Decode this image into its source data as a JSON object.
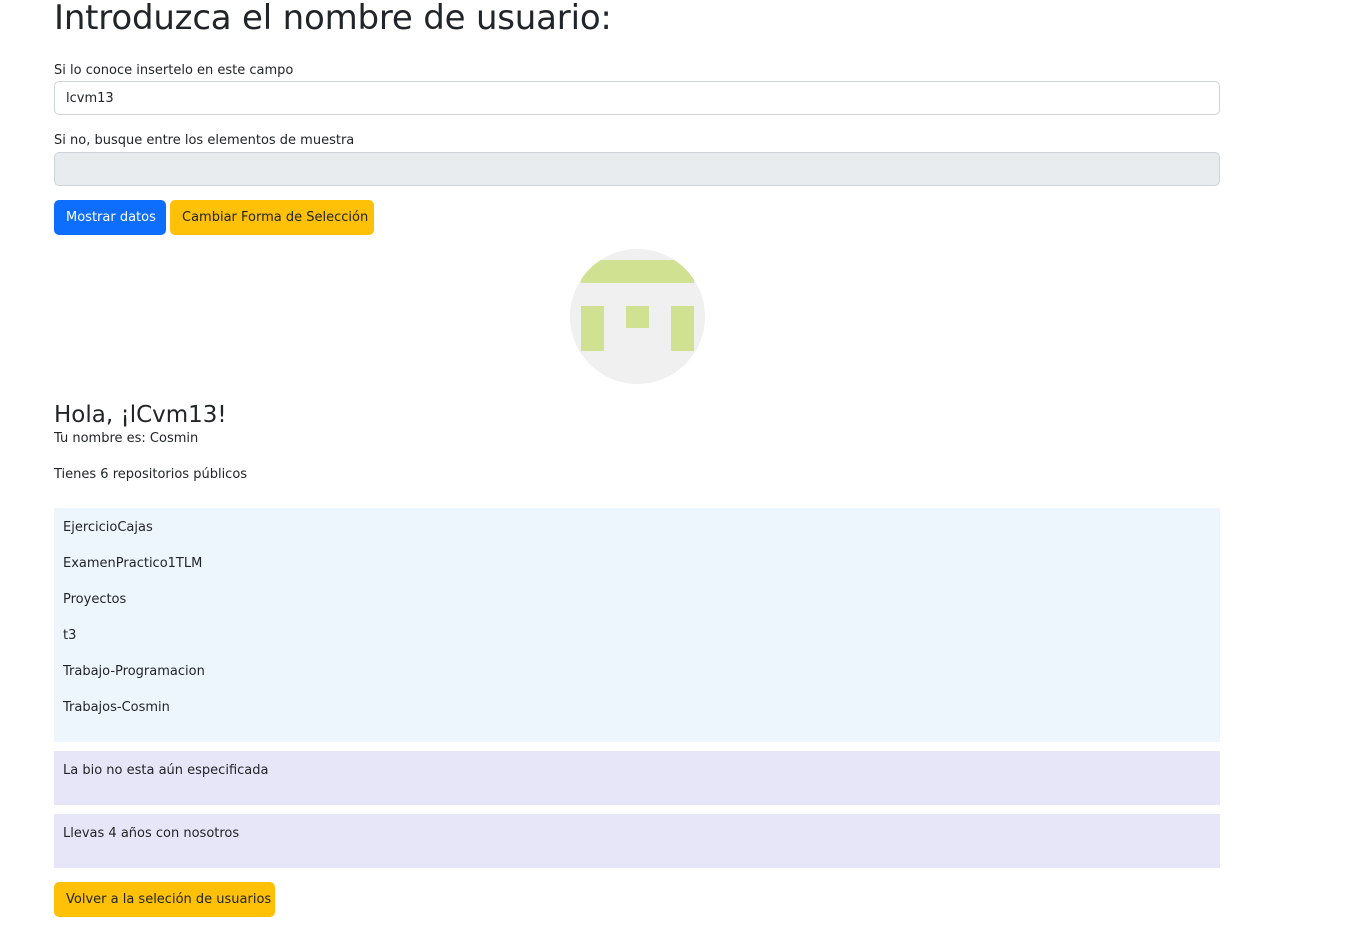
{
  "header": {
    "title": "Introduzca el nombre de usuario:"
  },
  "form": {
    "known_label": "Si lo conoce insertelo en este campo",
    "username_value": "lcvm13",
    "username_placeholder": "",
    "browse_label": "Si no, busque entre los elementos de muestra",
    "sample_selected": ""
  },
  "buttons": {
    "show_data": "Mostrar datos",
    "change_mode": "Cambiar Forma de Selección",
    "back": "Volver a la seleción de usuarios"
  },
  "avatar": {
    "icon": "identicon-avatar",
    "colors": {
      "background": "#f0f0f0",
      "pattern": "#d1e192"
    }
  },
  "profile": {
    "greeting": "Hola, ¡lCvm13!",
    "name_line": "Tu nombre es: Cosmin",
    "repos_line": "Tienes 6 repositorios públicos",
    "repositories": [
      "EjercicioCajas",
      "ExamenPractico1TLM",
      "Proyectos",
      "t3",
      "Trabajo-Programacion",
      "Trabajos-Cosmin"
    ],
    "bio": "La bio no esta aún especificada",
    "membership": "Llevas 4 años con nosotros"
  },
  "colors": {
    "primary": "#0d6efd",
    "warning": "#ffc107",
    "repo_list_bg": "#eef6fd",
    "info_box_bg": "#e6e6f8",
    "disabled_select_bg": "#e9ecef"
  }
}
